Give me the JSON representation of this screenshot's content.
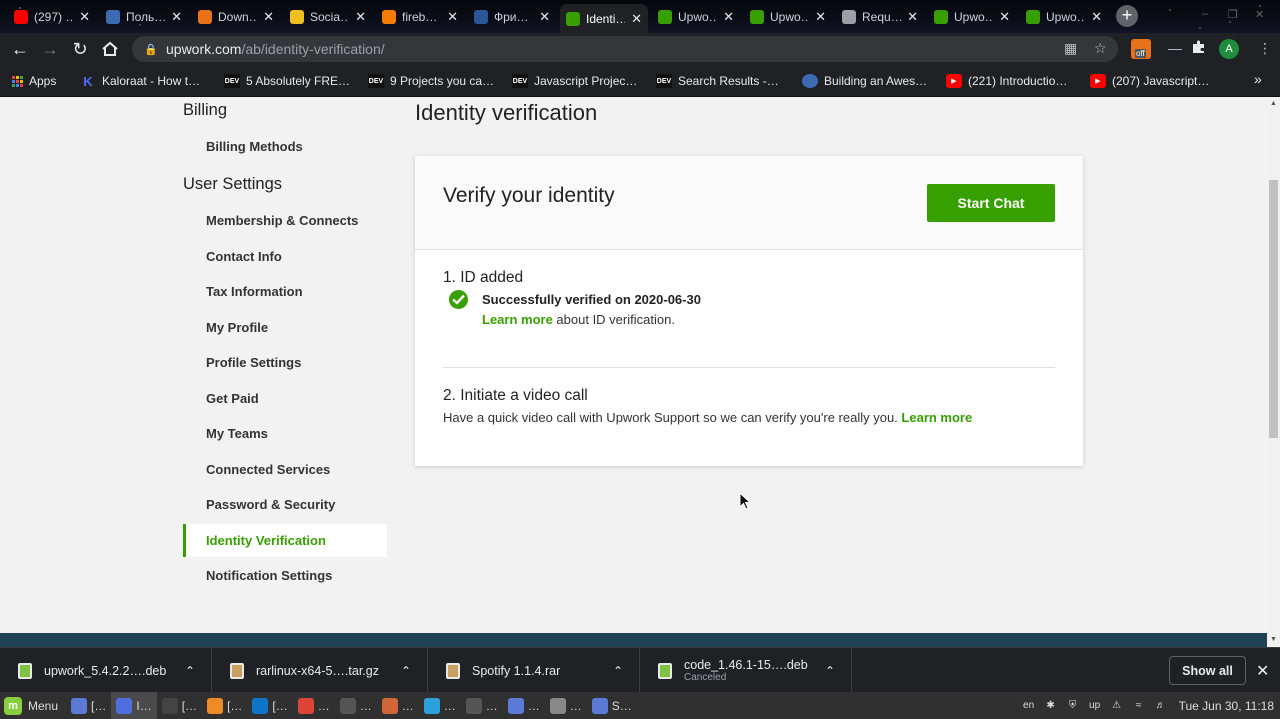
{
  "browser": {
    "tabs": [
      {
        "title": "(297) …",
        "favicon": "youtube-icon",
        "color": "#ff0000"
      },
      {
        "title": "Поль…",
        "favicon": "wordpress-icon",
        "color": "#3d6bb3"
      },
      {
        "title": "Down…",
        "favicon": "download-site-icon",
        "color": "#e8711a"
      },
      {
        "title": "Socia…",
        "favicon": "social-icon",
        "color": "#f0c020"
      },
      {
        "title": "fireb…",
        "favicon": "firebase-icon",
        "color": "#f57c00"
      },
      {
        "title": "Фри…",
        "favicon": "word-icon",
        "color": "#2b579a"
      },
      {
        "title": "Identi…",
        "favicon": "upwork-icon",
        "color": "#37a000"
      },
      {
        "title": "Upwo…",
        "favicon": "upwork-icon",
        "color": "#37a000"
      },
      {
        "title": "Upwo…",
        "favicon": "upwork-icon",
        "color": "#37a000"
      },
      {
        "title": "Requ…",
        "favicon": "globe-icon",
        "color": "#9aa0a6"
      },
      {
        "title": "Upwo…",
        "favicon": "upwork-icon",
        "color": "#37a000"
      },
      {
        "title": "Upwo…",
        "favicon": "upwork-icon",
        "color": "#37a000"
      }
    ],
    "active_tab_index": 6,
    "url_host": "upwork.com",
    "url_path": "/ab/identity-verification/",
    "profile_initial": "A",
    "extension_badge": "off",
    "bookmarks": [
      {
        "label": "Apps",
        "icon": "apps-icon"
      },
      {
        "label": "Kaloraat - How t…",
        "icon": "kaloraat-icon"
      },
      {
        "label": "5 Absolutely FRE…",
        "icon": "dev-icon"
      },
      {
        "label": "9 Projects you ca…",
        "icon": "dev-icon"
      },
      {
        "label": "Javascript Projec…",
        "icon": "dev-icon"
      },
      {
        "label": "Search Results -…",
        "icon": "dev-icon"
      },
      {
        "label": "Building an Awes…",
        "icon": "firefox-icon"
      },
      {
        "label": "(221) Introductio…",
        "icon": "youtube-icon"
      },
      {
        "label": "(207) Javascript…",
        "icon": "youtube-icon"
      }
    ],
    "dev_badge": "DEV",
    "more_bookmarks": "»"
  },
  "sidebar": {
    "billing_heading": "Billing",
    "billing_items": [
      "Billing Methods"
    ],
    "user_settings_heading": "User Settings",
    "user_items": [
      "Membership & Connects",
      "Contact Info",
      "Tax Information",
      "My Profile",
      "Profile Settings",
      "Get Paid",
      "My Teams",
      "Connected Services",
      "Password & Security",
      "Identity Verification",
      "Notification Settings"
    ],
    "active_item": "Identity Verification"
  },
  "main": {
    "page_title": "Identity verification",
    "card_title": "Verify your identity",
    "start_chat_label": "Start Chat",
    "step1": {
      "title": "1. ID added",
      "status": "Successfully verified on 2020-06-30",
      "learn_more_link": "Learn more",
      "learn_more_suffix": " about ID verification."
    },
    "step2": {
      "title": "2. Initiate a video call",
      "description": "Have a quick video call with Upwork Support so we can verify you're really you. ",
      "learn_more_link": "Learn more"
    }
  },
  "downloads": {
    "items": [
      {
        "name": "upwork_5.4.2.2….deb",
        "sub": "",
        "icon": "deb-file-icon"
      },
      {
        "name": "rarlinux-x64-5….tar.gz",
        "sub": "",
        "icon": "archive-file-icon"
      },
      {
        "name": "Spotify 1.1.4.rar",
        "sub": "",
        "icon": "archive-file-icon"
      },
      {
        "name": "code_1.46.1-15….deb",
        "sub": "Canceled",
        "icon": "deb-file-icon"
      }
    ],
    "show_all_label": "Show all"
  },
  "taskbar": {
    "menu_label": "Menu",
    "items": [
      "[…",
      "I…",
      "[…",
      "[…",
      "[…",
      "…",
      "…",
      "…",
      "…",
      "…",
      "…",
      "…",
      "S…"
    ],
    "language": "en",
    "clock": "Tue Jun 30, 11:18"
  },
  "colors": {
    "upwork_green": "#37a000",
    "page_bg": "#f2f2f2",
    "chrome_dark": "#202124"
  }
}
